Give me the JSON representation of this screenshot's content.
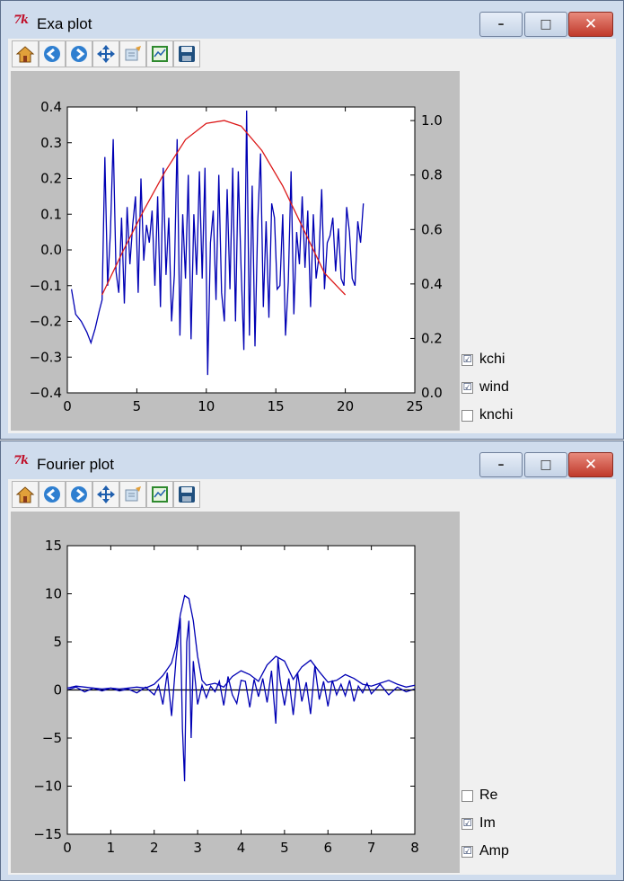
{
  "exa_window": {
    "title": "Exa plot",
    "controls": [
      "–",
      "□",
      "✕"
    ],
    "toolbar": [
      "home-icon",
      "back-arrow-icon",
      "forward-arrow-icon",
      "pan-icon",
      "zoom-icon",
      "subplots-icon",
      "save-icon"
    ],
    "checkboxes": [
      {
        "label": "kchi",
        "checked": "☑"
      },
      {
        "label": "wind",
        "checked": "☑"
      },
      {
        "label": "knchi",
        "checked": ""
      }
    ]
  },
  "fourier_window": {
    "title": "Fourier plot",
    "controls": [
      "–",
      "□",
      "✕"
    ],
    "toolbar": [
      "home-icon",
      "back-arrow-icon",
      "forward-arrow-icon",
      "pan-icon",
      "zoom-icon",
      "subplots-icon",
      "save-icon"
    ],
    "checkboxes": [
      {
        "label": "Re",
        "checked": ""
      },
      {
        "label": "Im",
        "checked": "☑"
      },
      {
        "label": "Amp",
        "checked": "☑"
      }
    ]
  },
  "chart_data": [
    {
      "type": "line",
      "title": "",
      "xlim": [
        0,
        25
      ],
      "ylim": [
        -0.4,
        0.4
      ],
      "y2lim": [
        0.0,
        1.05
      ],
      "x_ticks": [
        "0",
        "5",
        "10",
        "15",
        "20",
        "25"
      ],
      "y_ticks": [
        "0.4",
        "0.3",
        "0.2",
        "0.1",
        "0.0",
        "−0.1",
        "−0.2",
        "−0.3",
        "−0.4"
      ],
      "y2_ticks": [
        "1.0",
        "0.8",
        "0.6",
        "0.4",
        "0.2",
        "0.0"
      ],
      "series": [
        {
          "color": "#0000b4",
          "axis": "left",
          "x": [
            0.3,
            0.6,
            1.0,
            1.4,
            1.7,
            2.0,
            2.3,
            2.5,
            2.7,
            2.9,
            3.1,
            3.3,
            3.5,
            3.7,
            3.9,
            4.1,
            4.3,
            4.5,
            4.7,
            4.9,
            5.1,
            5.3,
            5.5,
            5.7,
            5.9,
            6.1,
            6.3,
            6.5,
            6.7,
            6.9,
            7.1,
            7.3,
            7.5,
            7.7,
            7.9,
            8.1,
            8.3,
            8.5,
            8.7,
            8.9,
            9.1,
            9.3,
            9.5,
            9.7,
            9.9,
            10.1,
            10.3,
            10.5,
            10.7,
            10.9,
            11.1,
            11.3,
            11.5,
            11.7,
            11.9,
            12.1,
            12.3,
            12.5,
            12.7,
            12.9,
            13.1,
            13.3,
            13.5,
            13.7,
            13.9,
            14.1,
            14.3,
            14.5,
            14.7,
            14.9,
            15.1,
            15.3,
            15.5,
            15.7,
            15.9,
            16.1,
            16.3,
            16.5,
            16.7,
            16.9,
            17.1,
            17.3,
            17.5,
            17.7,
            17.9,
            18.1,
            18.3,
            18.5,
            18.7,
            18.9,
            19.1,
            19.3,
            19.5,
            19.7,
            19.9,
            20.1,
            20.3,
            20.5,
            20.7,
            20.9,
            21.1,
            21.3
          ],
          "y": [
            -0.11,
            -0.18,
            -0.2,
            -0.23,
            -0.26,
            -0.22,
            -0.17,
            -0.14,
            0.26,
            -0.1,
            0.05,
            0.31,
            -0.06,
            -0.12,
            0.09,
            -0.15,
            0.12,
            -0.04,
            0.07,
            0.15,
            -0.12,
            0.2,
            -0.03,
            0.07,
            0.02,
            0.11,
            -0.1,
            0.15,
            -0.16,
            0.23,
            -0.07,
            0.09,
            -0.2,
            -0.07,
            0.31,
            -0.24,
            0.1,
            -0.08,
            0.21,
            -0.25,
            0.1,
            -0.07,
            0.22,
            -0.08,
            0.23,
            -0.35,
            0.02,
            0.11,
            -0.14,
            0.21,
            -0.12,
            -0.2,
            0.17,
            -0.11,
            0.23,
            -0.2,
            0.22,
            -0.05,
            -0.28,
            0.39,
            -0.24,
            0.18,
            -0.27,
            0.08,
            0.27,
            -0.16,
            0.08,
            -0.19,
            0.13,
            0.09,
            -0.11,
            -0.1,
            0.1,
            -0.24,
            -0.09,
            0.22,
            -0.18,
            0.05,
            -0.04,
            0.15,
            -0.05,
            0.11,
            -0.16,
            0.1,
            -0.08,
            -0.02,
            0.17,
            -0.11,
            0.02,
            0.04,
            0.09,
            -0.06,
            0.06,
            -0.08,
            -0.1,
            0.12,
            0.05,
            -0.08,
            -0.1,
            0.08,
            0.02,
            0.13
          ]
        },
        {
          "color": "#dc1a1a",
          "axis": "right",
          "x": [
            2.5,
            4,
            5.5,
            7,
            8.5,
            10,
            11.3,
            12.5,
            14,
            15.5,
            17,
            18.5,
            20
          ],
          "y": [
            0.36,
            0.52,
            0.67,
            0.81,
            0.93,
            0.99,
            1.0,
            0.98,
            0.89,
            0.76,
            0.6,
            0.44,
            0.36
          ]
        }
      ]
    },
    {
      "type": "line",
      "title": "",
      "xlim": [
        0,
        8
      ],
      "ylim": [
        -15,
        15
      ],
      "x_ticks": [
        "0",
        "1",
        "2",
        "3",
        "4",
        "5",
        "6",
        "7",
        "8"
      ],
      "y_ticks": [
        "15",
        "10",
        "5",
        "0",
        "−5",
        "−10",
        "−15"
      ],
      "series": [
        {
          "color": "#0000b4",
          "name": "Amp",
          "x": [
            0,
            0.2,
            0.4,
            0.6,
            0.8,
            1.0,
            1.2,
            1.4,
            1.6,
            1.8,
            2.0,
            2.2,
            2.4,
            2.5,
            2.6,
            2.7,
            2.8,
            2.9,
            3.0,
            3.1,
            3.2,
            3.4,
            3.6,
            3.8,
            4.0,
            4.2,
            4.4,
            4.6,
            4.8,
            5.0,
            5.2,
            5.4,
            5.6,
            5.8,
            6.0,
            6.2,
            6.4,
            6.6,
            6.8,
            7.0,
            7.2,
            7.4,
            7.6,
            7.8,
            8.0
          ],
          "y": [
            0.2,
            0.4,
            0.3,
            0.2,
            0.1,
            0.2,
            0.1,
            0.2,
            0.3,
            0.2,
            0.6,
            1.5,
            2.8,
            4.5,
            7.8,
            9.8,
            9.5,
            7.2,
            3.5,
            1.0,
            0.5,
            0.7,
            0.3,
            1.4,
            2.0,
            1.6,
            0.9,
            2.6,
            3.5,
            3.0,
            1.1,
            2.4,
            3.1,
            1.9,
            0.8,
            1.0,
            1.6,
            1.2,
            0.6,
            0.4,
            0.7,
            1.0,
            0.6,
            0.3,
            0.5
          ]
        },
        {
          "color": "#0000b4",
          "name": "Im",
          "x": [
            0,
            0.2,
            0.4,
            0.6,
            0.8,
            1.0,
            1.2,
            1.4,
            1.6,
            1.8,
            2.0,
            2.1,
            2.2,
            2.3,
            2.4,
            2.5,
            2.6,
            2.65,
            2.7,
            2.75,
            2.8,
            2.85,
            2.9,
            3.0,
            3.1,
            3.2,
            3.3,
            3.4,
            3.5,
            3.6,
            3.7,
            3.8,
            3.9,
            4.0,
            4.1,
            4.2,
            4.3,
            4.4,
            4.5,
            4.6,
            4.7,
            4.8,
            4.85,
            4.9,
            5.0,
            5.1,
            5.2,
            5.3,
            5.4,
            5.5,
            5.6,
            5.7,
            5.8,
            5.9,
            6.0,
            6.1,
            6.2,
            6.3,
            6.4,
            6.5,
            6.6,
            6.7,
            6.8,
            6.9,
            7.0,
            7.2,
            7.4,
            7.6,
            7.8,
            8.0
          ],
          "y": [
            0,
            0.3,
            -0.2,
            0.2,
            -0.1,
            0.2,
            -0.1,
            0.1,
            -0.3,
            0.3,
            -0.5,
            0.5,
            -1.5,
            1.8,
            -2.7,
            3.0,
            7.5,
            -4.0,
            -9.5,
            5.0,
            7.2,
            -5.0,
            3.0,
            -1.5,
            0.5,
            -0.8,
            0.4,
            -0.2,
            0.9,
            -1.6,
            1.4,
            -0.5,
            -1.4,
            1.0,
            0.9,
            -1.8,
            1.1,
            -0.7,
            1.2,
            -1.3,
            2.0,
            -3.5,
            3.3,
            1.0,
            -1.6,
            1.2,
            -2.6,
            1.8,
            -1.2,
            0.8,
            -2.5,
            2.5,
            -1.0,
            0.9,
            -1.7,
            1.0,
            -0.5,
            0.6,
            -0.6,
            1.0,
            -1.2,
            0.4,
            -0.3,
            0.7,
            -0.4,
            0.6,
            -0.5,
            0.3,
            -0.2,
            0.1
          ]
        }
      ]
    }
  ]
}
